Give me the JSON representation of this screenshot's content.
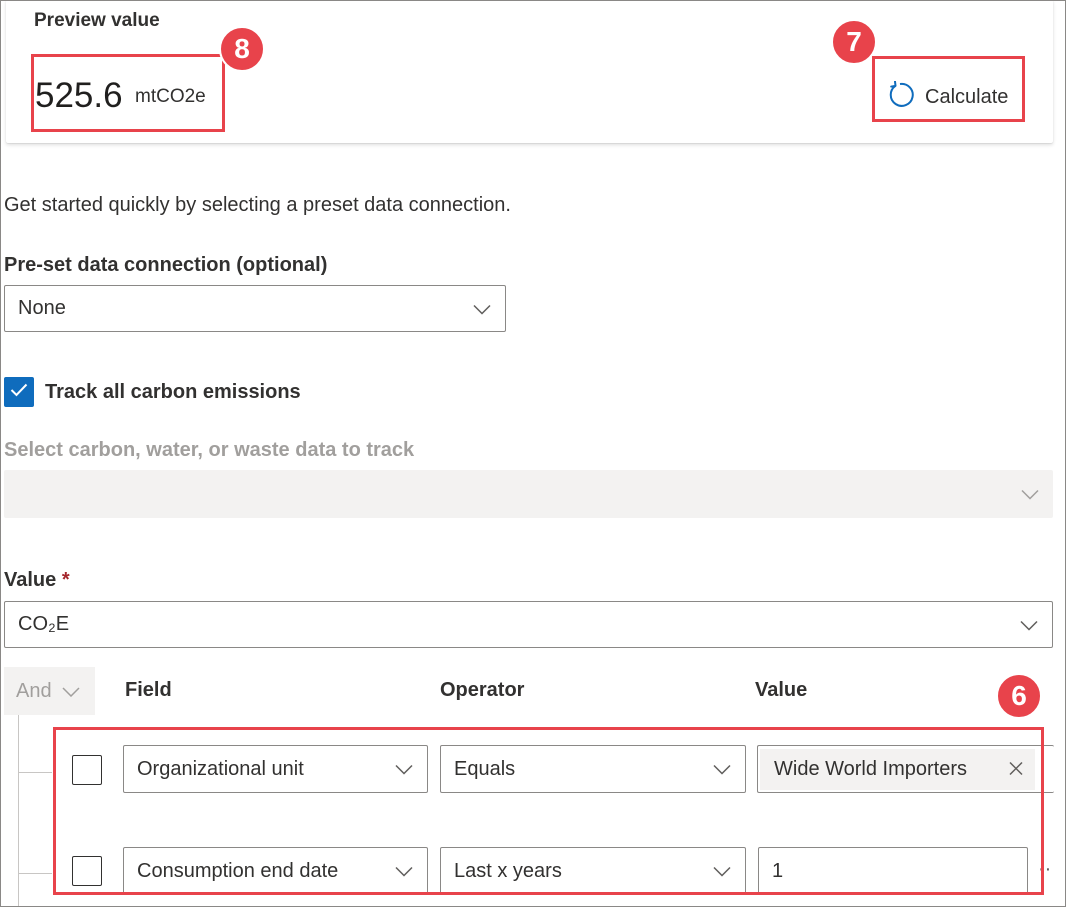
{
  "preview": {
    "label": "Preview value",
    "number": "525.6",
    "unit": "mtCO2e",
    "calculate_label": "Calculate"
  },
  "annotations": {
    "badge_8": "8",
    "badge_7": "7",
    "badge_6": "6"
  },
  "intro": "Get started quickly by selecting a preset data connection.",
  "preset": {
    "label": "Pre-set data connection (optional)",
    "selected": "None"
  },
  "track_all": {
    "label": "Track all carbon emissions",
    "checked": true
  },
  "select_data": {
    "label": "Select carbon, water, or waste data to track",
    "selected": ""
  },
  "value_field": {
    "label": "Value",
    "required_marker": "*",
    "selected": "CO₂E"
  },
  "filter": {
    "group_operator": "And",
    "headers": {
      "field": "Field",
      "operator": "Operator",
      "value": "Value"
    },
    "rows": [
      {
        "field": "Organizational unit",
        "operator": "Equals",
        "value": "Wide World Importers"
      },
      {
        "field": "Consumption end date",
        "operator": "Last x years",
        "value": "1"
      }
    ],
    "more_indicator": "··"
  },
  "colors": {
    "accent": "#0f6cbd",
    "annotation": "#e8434b"
  },
  "icons": [
    "refresh-icon",
    "chevron-down-icon",
    "checkmark-icon",
    "close-icon"
  ]
}
